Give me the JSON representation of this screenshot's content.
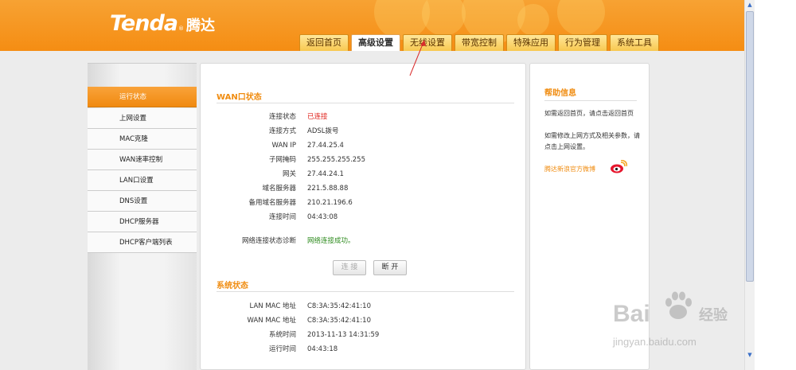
{
  "header": {
    "logo_en": "Tenda",
    "logo_reg": "®",
    "logo_cn": "腾达",
    "tabs": [
      {
        "label": "返回首页"
      },
      {
        "label": "高级设置"
      },
      {
        "label": "无线设置"
      },
      {
        "label": "带宽控制"
      },
      {
        "label": "特殊应用"
      },
      {
        "label": "行为管理"
      },
      {
        "label": "系统工具"
      }
    ],
    "active_tab": "高级设置",
    "colors": {
      "header": "#f58d13",
      "accent": "#f08c10"
    }
  },
  "sidebar": {
    "items": [
      {
        "label": "运行状态"
      },
      {
        "label": "上网设置"
      },
      {
        "label": "MAC克隆"
      },
      {
        "label": "WAN速率控制"
      },
      {
        "label": "LAN口设置"
      },
      {
        "label": "DNS设置"
      },
      {
        "label": "DHCP服务器"
      },
      {
        "label": "DHCP客户端列表"
      }
    ],
    "active": "运行状态"
  },
  "wan": {
    "title": "WAN口状态",
    "rows": [
      {
        "key": "连接状态",
        "value": "已连接"
      },
      {
        "key": "连接方式",
        "value": "ADSL拨号"
      },
      {
        "key": "WAN IP",
        "value": "27.44.25.4"
      },
      {
        "key": "子网掩码",
        "value": "255.255.255.255"
      },
      {
        "key": "网关",
        "value": "27.44.24.1"
      },
      {
        "key": "域名服务器",
        "value": "221.5.88.88"
      },
      {
        "key": "备用域名服务器",
        "value": "210.21.196.6"
      },
      {
        "key": "连接时间",
        "value": "04:43:08"
      }
    ],
    "diag_key": "网络连接状态诊断",
    "diag_value": "网络连接成功。",
    "connect_label": "连 接",
    "disconnect_label": "断 开"
  },
  "system": {
    "title": "系统状态",
    "rows": [
      {
        "key": "LAN MAC 地址",
        "value": "C8:3A:35:42:41:10"
      },
      {
        "key": "WAN MAC 地址",
        "value": "C8:3A:35:42:41:10"
      },
      {
        "key": "系统时间",
        "value": "2013-11-13 14:31:59"
      },
      {
        "key": "运行时间",
        "value": "04:43:18"
      }
    ]
  },
  "help": {
    "title": "帮助信息",
    "text1": "如需返回首页，请点击返回首页",
    "text2": "如需修改上网方式及相关参数，请点击上网设置。",
    "link": "腾达新浪官方微博",
    "weibo_icon": "weibo-icon"
  },
  "watermark": {
    "brand": "Bai",
    "brand_cn": "经验",
    "url": "jingyan.baidu.com"
  }
}
